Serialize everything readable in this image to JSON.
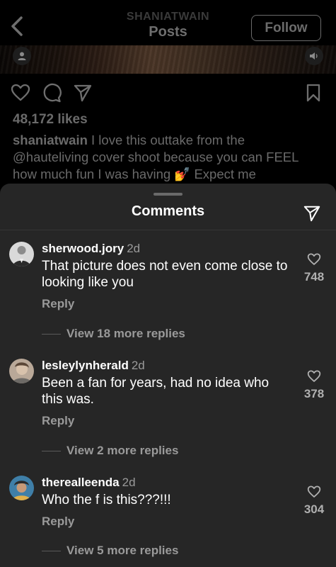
{
  "header": {
    "username": "SHANIATWAIN",
    "title": "Posts",
    "follow_label": "Follow"
  },
  "post": {
    "likes": "48,172 likes",
    "caption_user": "shaniatwain",
    "caption_text": " I love this outtake from the @hauteliving cover shoot because you can FEEL how much fun I was having 💅 Expect me"
  },
  "sheet": {
    "title": "Comments"
  },
  "comments": [
    {
      "username": "sherwood.jory",
      "time": "2d",
      "text": "That picture does not even come close to looking like you",
      "reply_label": "Reply",
      "likes": "748",
      "view_more": "View 18 more replies"
    },
    {
      "username": "lesleylynherald",
      "time": "2d",
      "text": "Been a fan for years, had no idea who this was.",
      "reply_label": "Reply",
      "likes": "378",
      "view_more": "View 2 more replies"
    },
    {
      "username": "therealleenda",
      "time": "2d",
      "text": "Who the f is this???!!!",
      "reply_label": "Reply",
      "likes": "304",
      "view_more": "View 5 more replies"
    }
  ],
  "icons": {
    "back": "chevron-left-icon",
    "like": "heart-icon",
    "comment": "comment-bubble-icon",
    "share": "paper-plane-icon",
    "save": "bookmark-icon",
    "comment_like": "heart-outline-icon",
    "tagged_user": "user-icon",
    "sound": "speaker-icon"
  },
  "colors": {
    "sheet_bg": "#262626",
    "page_bg": "#000000",
    "muted_text": "#9a9a9a"
  }
}
